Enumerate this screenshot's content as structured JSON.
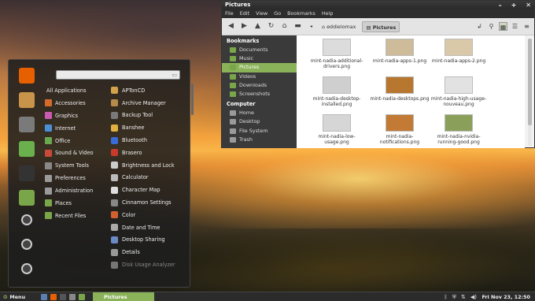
{
  "menu": {
    "search_placeholder": "",
    "favorites": [
      {
        "icon": "firefox-icon",
        "color": "#e66000"
      },
      {
        "icon": "software-manager-icon",
        "color": "#c8944a"
      },
      {
        "icon": "system-settings-icon",
        "color": "#7a7a7a"
      },
      {
        "icon": "terminal-green-icon",
        "color": "#6ab04c"
      },
      {
        "icon": "terminal-icon",
        "color": "#333333"
      },
      {
        "icon": "files-icon",
        "color": "#7aa64a"
      },
      {
        "icon": "lock-screen-icon",
        "color": "#444444"
      },
      {
        "icon": "logout-icon",
        "color": "#444444"
      },
      {
        "icon": "power-icon",
        "color": "#444444"
      }
    ],
    "categories": [
      {
        "label": "All Applications",
        "color": ""
      },
      {
        "label": "Accessories",
        "color": "#d26b2c"
      },
      {
        "label": "Graphics",
        "color": "#c85ab0"
      },
      {
        "label": "Internet",
        "color": "#4a8fd6"
      },
      {
        "label": "Office",
        "color": "#6aa84f"
      },
      {
        "label": "Sound & Video",
        "color": "#c84a3a"
      },
      {
        "label": "System Tools",
        "color": "#888888"
      },
      {
        "label": "Preferences",
        "color": "#9a9a9a"
      },
      {
        "label": "Administration",
        "color": "#9a9a9a"
      },
      {
        "label": "Places",
        "color": "#7aa64a"
      },
      {
        "label": "Recent Files",
        "color": "#7aa64a"
      }
    ],
    "apps": [
      {
        "label": "APTonCD",
        "color": "#d4a24a"
      },
      {
        "label": "Archive Manager",
        "color": "#b58a4a"
      },
      {
        "label": "Backup Tool",
        "color": "#7a7a7a"
      },
      {
        "label": "Banshee",
        "color": "#e0b040"
      },
      {
        "label": "Bluetooth",
        "color": "#3a6ad6"
      },
      {
        "label": "Brasero",
        "color": "#c83a2a"
      },
      {
        "label": "Brightness and Lock",
        "color": "#cccccc"
      },
      {
        "label": "Calculator",
        "color": "#bbbbbb"
      },
      {
        "label": "Character Map",
        "color": "#dddddd"
      },
      {
        "label": "Cinnamon Settings",
        "color": "#888888"
      },
      {
        "label": "Color",
        "color": "#d06030"
      },
      {
        "label": "Date and Time",
        "color": "#aaaaaa"
      },
      {
        "label": "Desktop Sharing",
        "color": "#6a8ac6"
      },
      {
        "label": "Details",
        "color": "#999999"
      },
      {
        "label": "Disk Usage Analyzer",
        "color": "#777777"
      }
    ]
  },
  "window": {
    "title": "Pictures",
    "menubar": [
      "File",
      "Edit",
      "View",
      "Go",
      "Bookmarks",
      "Help"
    ],
    "breadcrumbs": [
      "eddielomax",
      "Pictures"
    ],
    "sidebar": {
      "bookmarks_header": "Bookmarks",
      "bookmarks": [
        "Documents",
        "Music",
        "Pictures",
        "Videos",
        "Downloads",
        "Screenshots"
      ],
      "selected": "Pictures",
      "computer_header": "Computer",
      "computer": [
        "Home",
        "Desktop",
        "File System",
        "Trash"
      ]
    },
    "files": [
      {
        "name": "mint-nadia-additional-drivers.png",
        "thumb": "#dcdcdc"
      },
      {
        "name": "mint-nadia-apps-1.png",
        "thumb": "#cdbb99"
      },
      {
        "name": "mint-nadia-apps-2.png",
        "thumb": "#d9c9a8"
      },
      {
        "name": "mint-nadia-desktop-installed.png",
        "thumb": "#cfcfcf"
      },
      {
        "name": "mint-nadia-desktops.png",
        "thumb": "#b8772e"
      },
      {
        "name": "mint-nadia-high-usage-nouveau.png",
        "thumb": "#e2e2e2"
      },
      {
        "name": "mint-nadia-low-usage.png",
        "thumb": "#d6d6d6"
      },
      {
        "name": "mint-nadia-notifications.png",
        "thumb": "#c27a34"
      },
      {
        "name": "mint-nadia-nvidia-running-good.png",
        "thumb": "#8aa05a"
      }
    ]
  },
  "taskbar": {
    "menu_label": "Menu",
    "launchers": [
      {
        "icon": "show-desktop-icon",
        "color": "#5a7fb0"
      },
      {
        "icon": "firefox-icon",
        "color": "#e66000"
      },
      {
        "icon": "terminal-icon",
        "color": "#555555"
      },
      {
        "icon": "settings-icon",
        "color": "#888888"
      },
      {
        "icon": "files-icon",
        "color": "#7aa64a"
      }
    ],
    "active_window": "Pictures",
    "clock": "Fri Nov 23, 12:50"
  },
  "colors": {
    "accent": "#8ab259"
  }
}
